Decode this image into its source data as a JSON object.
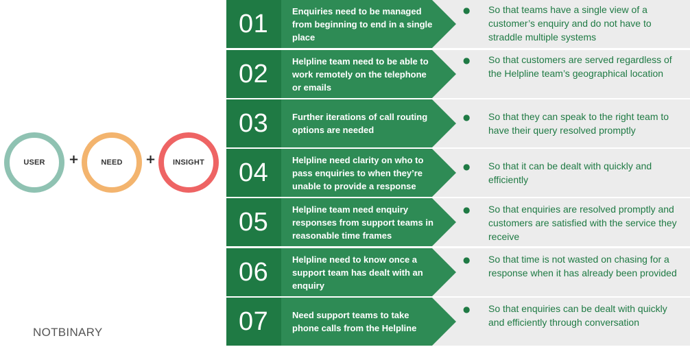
{
  "colors": {
    "green_dark": "#1f7a44",
    "green_mid": "#2e8b55",
    "grey_band": "#ececec",
    "user_ring": "#8fc2b2",
    "need_ring": "#f3b46e",
    "insight_ring": "#ee6464"
  },
  "equation": {
    "user": "USER",
    "plus1": "+",
    "need": "NEED",
    "plus2": "+",
    "insight": "INSIGHT"
  },
  "logo": {
    "text": "NOTBINARY"
  },
  "rows": [
    {
      "number": "01",
      "need": "Enquiries need to be managed from beginning to end in a single place",
      "reason": "So that teams have a single view of a customer’s enquiry and do not have to straddle multiple systems"
    },
    {
      "number": "02",
      "need": "Helpline team need to be able to work remotely on the telephone or emails",
      "reason": "So that customers are served regardless of the Helpline team’s geographical location"
    },
    {
      "number": "03",
      "need": "Further iterations of call routing options are needed",
      "reason": "So that they can speak to the right team to have their query resolved promptly"
    },
    {
      "number": "04",
      "need": "Helpline need clarity on who to pass enquiries to when they’re unable to provide a response",
      "reason": "So that it can be dealt with quickly and efficiently"
    },
    {
      "number": "05",
      "need": "Helpline team need enquiry responses from support  teams in reasonable time frames",
      "reason": "So that enquiries are resolved promptly and customers are satisfied with the service they receive"
    },
    {
      "number": "06",
      "need": "Helpline need to know once a support team has dealt with an enquiry",
      "reason": "So that time is not wasted on chasing for a response when it has already been provided"
    },
    {
      "number": "07",
      "need": "Need support teams to take phone calls from the Helpline",
      "reason": "So that enquiries can be dealt with quickly and efficiently through conversation"
    }
  ]
}
